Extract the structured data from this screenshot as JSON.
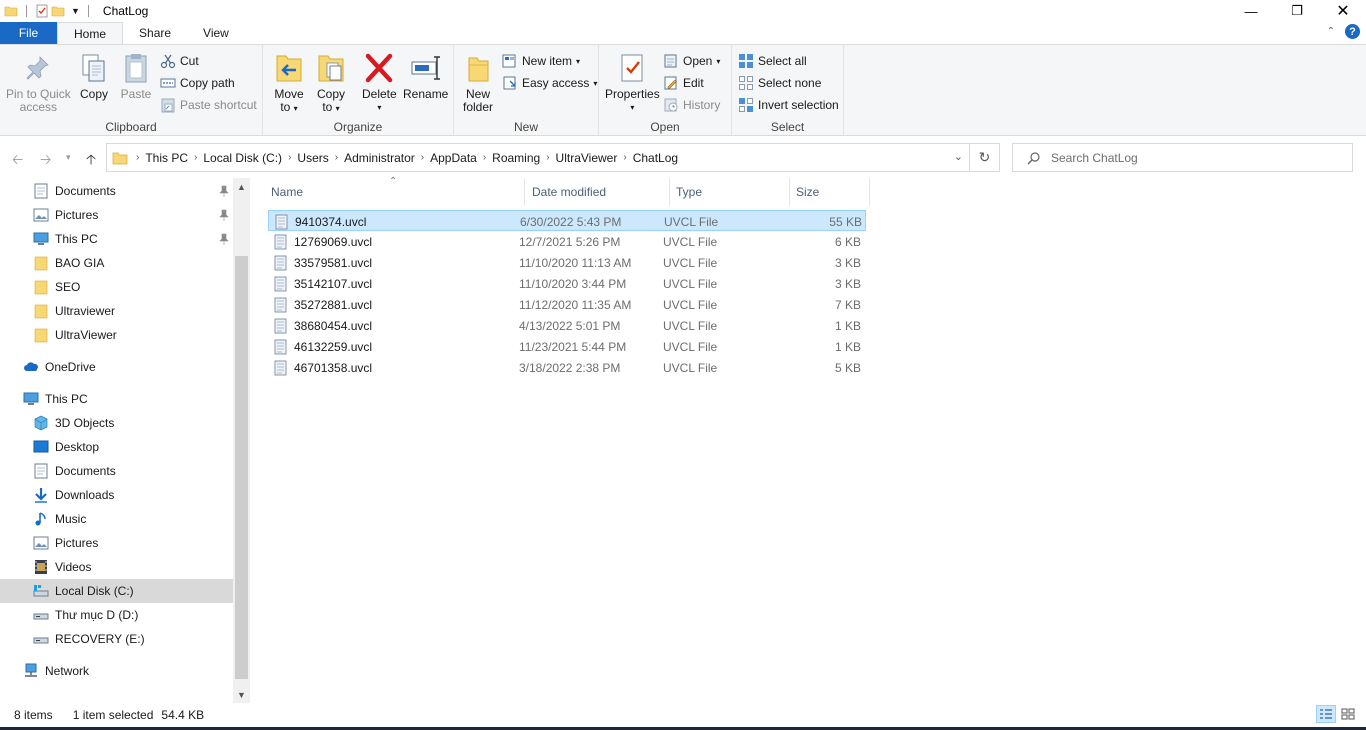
{
  "window": {
    "title": "ChatLog"
  },
  "ribbon_tabs": {
    "file": "File",
    "home": "Home",
    "share": "Share",
    "view": "View"
  },
  "ribbon": {
    "clipboard": {
      "label": "Clipboard",
      "pin_line1": "Pin to Quick",
      "pin_line2": "access",
      "copy": "Copy",
      "paste": "Paste",
      "cut": "Cut",
      "copy_path": "Copy path",
      "paste_shortcut": "Paste shortcut"
    },
    "organize": {
      "label": "Organize",
      "move_line1": "Move",
      "move_line2": "to",
      "copyto_line1": "Copy",
      "copyto_line2": "to",
      "delete": "Delete",
      "rename": "Rename"
    },
    "new": {
      "label": "New",
      "folder_line1": "New",
      "folder_line2": "folder",
      "new_item": "New item",
      "easy_access": "Easy access"
    },
    "open": {
      "label": "Open",
      "properties": "Properties",
      "open": "Open",
      "edit": "Edit",
      "history": "History"
    },
    "select": {
      "label": "Select",
      "select_all": "Select all",
      "select_none": "Select none",
      "invert": "Invert selection"
    }
  },
  "address": {
    "crumbs": [
      "This PC",
      "Local Disk (C:)",
      "Users",
      "Administrator",
      "AppData",
      "Roaming",
      "UltraViewer",
      "ChatLog"
    ],
    "search_placeholder": "Search ChatLog"
  },
  "nav": {
    "quick": [
      {
        "label": "Documents",
        "icon": "documents-icon",
        "pinned": true
      },
      {
        "label": "Pictures",
        "icon": "pictures-icon",
        "pinned": true
      },
      {
        "label": "This PC",
        "icon": "this-pc-icon",
        "pinned": true
      },
      {
        "label": "BAO GIA",
        "icon": "folder-icon",
        "pinned": false
      },
      {
        "label": "SEO",
        "icon": "folder-icon",
        "pinned": false
      },
      {
        "label": "Ultraviewer",
        "icon": "folder-icon",
        "pinned": false
      },
      {
        "label": "UltraViewer",
        "icon": "folder-icon",
        "pinned": false
      }
    ],
    "onedrive": "OneDrive",
    "thispc": "This PC",
    "pc_items": [
      {
        "label": "3D Objects",
        "icon": "3d-objects-icon"
      },
      {
        "label": "Desktop",
        "icon": "desktop-icon"
      },
      {
        "label": "Documents",
        "icon": "documents-icon"
      },
      {
        "label": "Downloads",
        "icon": "downloads-icon"
      },
      {
        "label": "Music",
        "icon": "music-icon"
      },
      {
        "label": "Pictures",
        "icon": "pictures-icon"
      },
      {
        "label": "Videos",
        "icon": "videos-icon"
      },
      {
        "label": "Local Disk (C:)",
        "icon": "local-disk-icon"
      },
      {
        "label": "Thư mục D (D:)",
        "icon": "drive-icon"
      },
      {
        "label": "RECOVERY (E:)",
        "icon": "drive-icon"
      }
    ],
    "network": "Network"
  },
  "columns": {
    "name": "Name",
    "date": "Date modified",
    "type": "Type",
    "size": "Size"
  },
  "files": [
    {
      "name": "9410374.uvcl",
      "date": "6/30/2022 5:43 PM",
      "type": "UVCL File",
      "size": "55 KB",
      "selected": true
    },
    {
      "name": "12769069.uvcl",
      "date": "12/7/2021 5:26 PM",
      "type": "UVCL File",
      "size": "6 KB",
      "selected": false
    },
    {
      "name": "33579581.uvcl",
      "date": "11/10/2020 11:13 AM",
      "type": "UVCL File",
      "size": "3 KB",
      "selected": false
    },
    {
      "name": "35142107.uvcl",
      "date": "11/10/2020 3:44 PM",
      "type": "UVCL File",
      "size": "3 KB",
      "selected": false
    },
    {
      "name": "35272881.uvcl",
      "date": "11/12/2020 11:35 AM",
      "type": "UVCL File",
      "size": "7 KB",
      "selected": false
    },
    {
      "name": "38680454.uvcl",
      "date": "4/13/2022 5:01 PM",
      "type": "UVCL File",
      "size": "1 KB",
      "selected": false
    },
    {
      "name": "46132259.uvcl",
      "date": "11/23/2021 5:44 PM",
      "type": "UVCL File",
      "size": "1 KB",
      "selected": false
    },
    {
      "name": "46701358.uvcl",
      "date": "3/18/2022 2:38 PM",
      "type": "UVCL File",
      "size": "5 KB",
      "selected": false
    }
  ],
  "status": {
    "count": "8 items",
    "selected": "1 item selected",
    "size": "54.4 KB"
  },
  "colors": {
    "accent": "#1a69c5",
    "selection": "#cce8ff",
    "folder": "#f8d775"
  }
}
